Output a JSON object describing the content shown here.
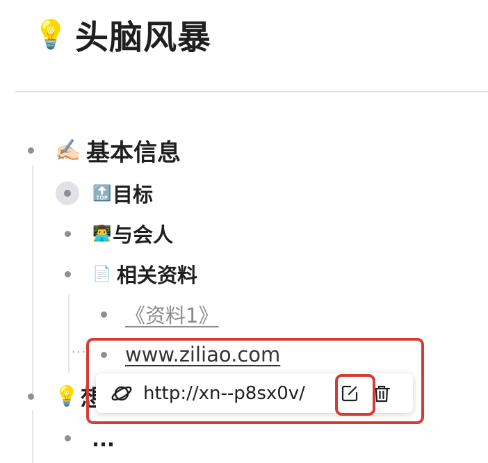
{
  "page": {
    "title": "头脑风暴",
    "title_icon": "💡"
  },
  "outline": {
    "basic_info": {
      "icon": "✍🏻",
      "label": "基本信息"
    },
    "goal": {
      "icon": "🔝",
      "label": "目标"
    },
    "attendees": {
      "icon": "👨‍💻",
      "label": "与会人"
    },
    "materials": {
      "icon": "📄",
      "label": "相关资料"
    },
    "material_link_1": {
      "label": "《资料1》"
    },
    "material_link_2": {
      "label": "www.ziliao.com"
    },
    "ideas": {
      "icon": "💡",
      "label": "想"
    },
    "ellipsis_item": {
      "label": "..."
    },
    "hidden_dots": "⋯"
  },
  "link_popover": {
    "url": "http://xn--p8sx0v/",
    "icon": "planet-link-icon",
    "actions": [
      "edit-icon",
      "trash-icon"
    ]
  },
  "colors": {
    "annotation_red": "#d53a35",
    "bullet": "#8d8f95",
    "collapsed_bullet_bg": "#e2e2e6",
    "muted_link": "#8a8a8a"
  }
}
